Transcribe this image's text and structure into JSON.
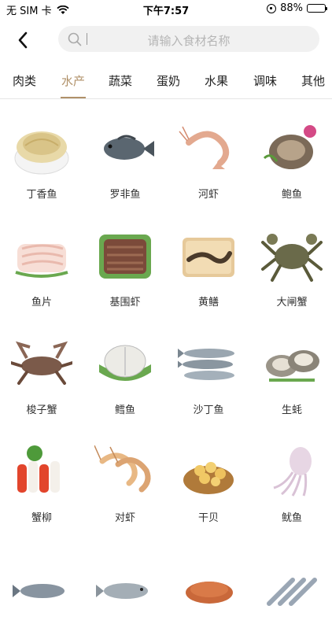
{
  "status_bar": {
    "carrier": "无 SIM 卡",
    "time": "下午7:57",
    "battery_percent": "88%",
    "battery_level": 0.88
  },
  "header": {
    "back_icon": "chevron-left-icon",
    "search": {
      "icon": "search-icon",
      "placeholder": "请输入食材名称"
    }
  },
  "tabs": [
    {
      "label": "肉类",
      "active": false
    },
    {
      "label": "水产",
      "active": true
    },
    {
      "label": "蔬菜",
      "active": false
    },
    {
      "label": "蛋奶",
      "active": false
    },
    {
      "label": "水果",
      "active": false
    },
    {
      "label": "调味",
      "active": false
    },
    {
      "label": "其他",
      "active": false
    }
  ],
  "accent_color": "#b09169",
  "items": [
    {
      "label": "丁香鱼",
      "image": "anchovy-bowl"
    },
    {
      "label": "罗非鱼",
      "image": "tilapia"
    },
    {
      "label": "河虾",
      "image": "river-shrimp"
    },
    {
      "label": "鲍鱼",
      "image": "abalone"
    },
    {
      "label": "鱼片",
      "image": "fish-slices"
    },
    {
      "label": "基围虾",
      "image": "shrimp-plate"
    },
    {
      "label": "黄鳝",
      "image": "eel-basket"
    },
    {
      "label": "大闸蟹",
      "image": "hairy-crab"
    },
    {
      "label": "梭子蟹",
      "image": "swimming-crab"
    },
    {
      "label": "鳕鱼",
      "image": "cod-steak"
    },
    {
      "label": "沙丁鱼",
      "image": "sardines"
    },
    {
      "label": "生蚝",
      "image": "oysters"
    },
    {
      "label": "蟹柳",
      "image": "crab-sticks"
    },
    {
      "label": "对虾",
      "image": "prawns"
    },
    {
      "label": "干贝",
      "image": "dried-scallops"
    },
    {
      "label": "鱿鱼",
      "image": "squid"
    },
    {
      "label": "",
      "image": "fish-1"
    },
    {
      "label": "",
      "image": "fish-2"
    },
    {
      "label": "",
      "image": "dried-shrimp"
    },
    {
      "label": "",
      "image": "small-fish"
    }
  ]
}
